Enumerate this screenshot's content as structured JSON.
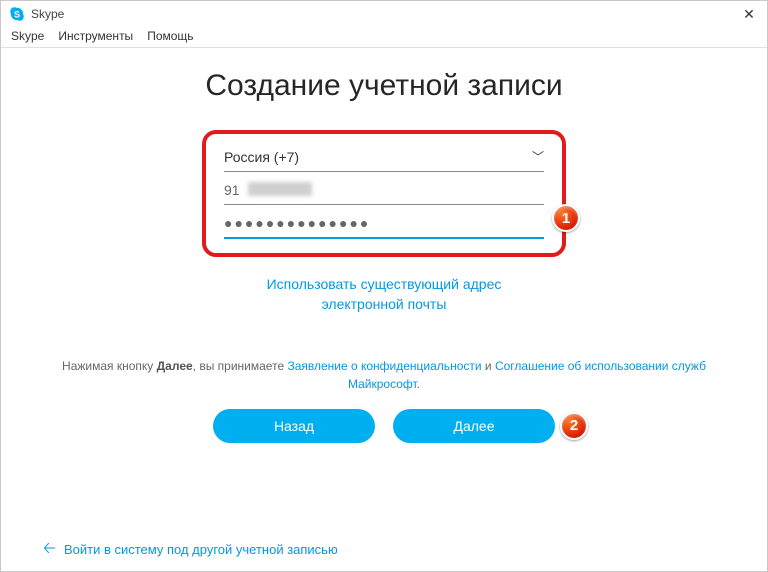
{
  "window": {
    "title": "Skype",
    "close_glyph": "✕"
  },
  "menu": {
    "items": [
      "Skype",
      "Инструменты",
      "Помощь"
    ]
  },
  "page": {
    "title": "Создание учетной записи"
  },
  "form": {
    "country_label": "Россия (+7)",
    "phone_value": "91",
    "password_value": "●●●●●●●●●●●●●●"
  },
  "alt_link": {
    "line1": "Использовать существующий адрес",
    "line2": "электронной почты"
  },
  "terms": {
    "prefix": "Нажимая кнопку ",
    "bold": "Далее",
    "mid": ", вы принимаете ",
    "link1": "Заявление о конфиденциальности",
    "and": " и ",
    "link2": "Соглашение об использовании служб Майкрософт",
    "suffix": "."
  },
  "buttons": {
    "back": "Назад",
    "next": "Далее"
  },
  "footer": {
    "text": "Войти в систему под другой учетной записью"
  },
  "badges": {
    "one": "1",
    "two": "2"
  }
}
